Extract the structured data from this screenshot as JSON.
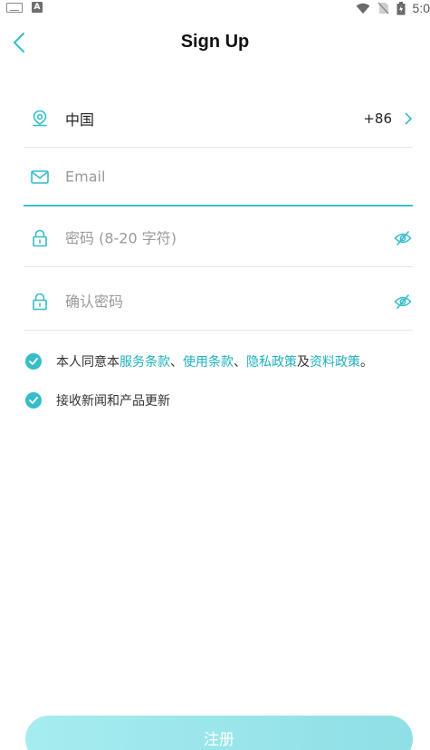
{
  "status_bar": {
    "time": "5:0"
  },
  "header": {
    "title": "Sign Up"
  },
  "form": {
    "country": {
      "name": "中国",
      "code": "+86"
    },
    "email": {
      "placeholder": "Email",
      "value": ""
    },
    "password": {
      "placeholder": "密码 (8-20 字符)",
      "value": ""
    },
    "confirm_password": {
      "placeholder": "确认密码",
      "value": ""
    }
  },
  "agreements": {
    "terms": {
      "prefix": "本人同意本",
      "terms_link": "服务条款",
      "sep1": "、",
      "use_link": "使用条款",
      "sep2": "、",
      "privacy_link": "隐私政策",
      "and": "及",
      "data_link": "资料政策",
      "end": "。",
      "checked": true
    },
    "newsletter": {
      "label": "接收新闻和产品更新",
      "checked": true
    }
  },
  "submit": {
    "label": "注册"
  },
  "colors": {
    "accent": "#35bdc9",
    "link": "#1fb0bd",
    "button": "#9ae6eb"
  },
  "icons": {
    "back": "chevron-left-icon",
    "location": "location-pin-icon",
    "email": "envelope-icon",
    "lock": "lock-icon",
    "eye": "eye-off-icon",
    "check": "check-circle-icon"
  }
}
